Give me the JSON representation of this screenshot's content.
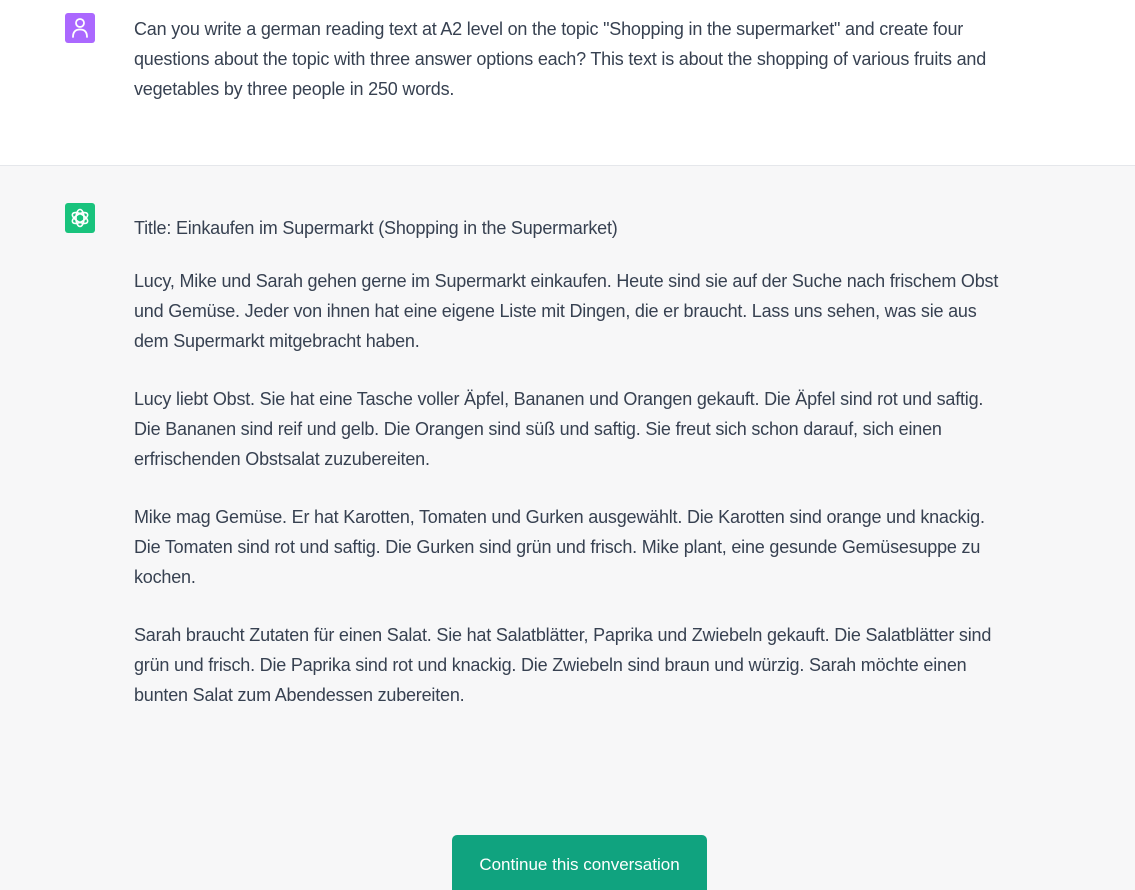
{
  "user_message": {
    "avatar_icon": "user-icon",
    "avatar_color": "#ab68ff",
    "text": "Can you write a german reading text at A2 level on the topic \"Shopping in the supermarket\" and create four questions about the topic with three answer options each? This text is about the shopping of various fruits and vegetables by three people in 250 words."
  },
  "assistant_message": {
    "avatar_icon": "openai-logo-icon",
    "avatar_color": "#19c37d",
    "title": "Title: Einkaufen im Supermarkt (Shopping in the Supermarket)",
    "paragraphs": [
      "Lucy, Mike und Sarah gehen gerne im Supermarkt einkaufen. Heute sind sie auf der Suche nach frischem Obst und Gemüse. Jeder von ihnen hat eine eigene Liste mit Dingen, die er braucht. Lass uns sehen, was sie aus dem Supermarkt mitgebracht haben.",
      "Lucy liebt Obst. Sie hat eine Tasche voller Äpfel, Bananen und Orangen gekauft. Die Äpfel sind rot und saftig. Die Bananen sind reif und gelb. Die Orangen sind süß und saftig. Sie freut sich schon darauf, sich einen erfrischenden Obstsalat zuzubereiten.",
      "Mike mag Gemüse. Er hat Karotten, Tomaten und Gurken ausgewählt. Die Karotten sind orange und knackig. Die Tomaten sind rot und saftig. Die Gurken sind grün und frisch. Mike plant, eine gesunde Gemüsesuppe zu kochen.",
      "Sarah braucht Zutaten für einen Salat. Sie hat Salatblätter, Paprika und Zwiebeln gekauft. Die Salatblätter sind grün und frisch. Die Paprika sind rot und knackig. Die Zwiebeln sind braun und würzig. Sarah möchte einen bunten Salat zum Abendessen zubereiten."
    ]
  },
  "continue_button": {
    "label": "Continue this conversation",
    "color": "#10a37f"
  }
}
